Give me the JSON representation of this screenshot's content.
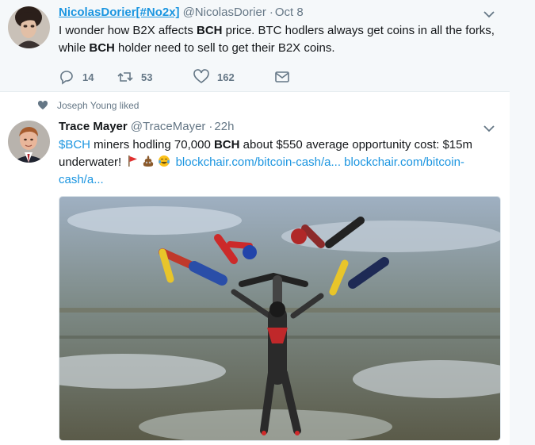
{
  "tweets": [
    {
      "fullname": "NicolasDorier[#No2x]",
      "username": "@NicolasDorier",
      "dot": "·",
      "time": "Oct 8",
      "text_parts": [
        {
          "t": "I wonder how B2X affects "
        },
        {
          "t": "BCH",
          "bold": true
        },
        {
          "t": " price. BTC hodlers always get coins in all the forks, while "
        },
        {
          "t": "BCH",
          "bold": true
        },
        {
          "t": " holder need to sell to get their B2X coins."
        }
      ],
      "actions": {
        "replies": "14",
        "retweets": "53",
        "likes": "162"
      }
    },
    {
      "context": "Joseph Young liked",
      "fullname": "Trace Mayer",
      "username": "@TraceMayer",
      "dot": "·",
      "time": "22h",
      "cashtag": "$BCH",
      "text_a": " miners hodling 70,000 ",
      "bold_bch": "BCH",
      "text_b": " about $550 average opportunity cost: $15m underwater!",
      "emojis": [
        "triangular-flag-emoji",
        "pile-of-poo-emoji",
        "tears-of-joy-emoji"
      ],
      "link_1": "blockchair.com/bitcoin-cash/a...",
      "link_2": "blockchair.com/bitcoin-cash/a..."
    }
  ],
  "colors": {
    "link": "#1b95e0",
    "muted": "#657786",
    "text": "#14171a",
    "like_heart": "#657786"
  },
  "media": {
    "icon": "skydivers-photo"
  }
}
